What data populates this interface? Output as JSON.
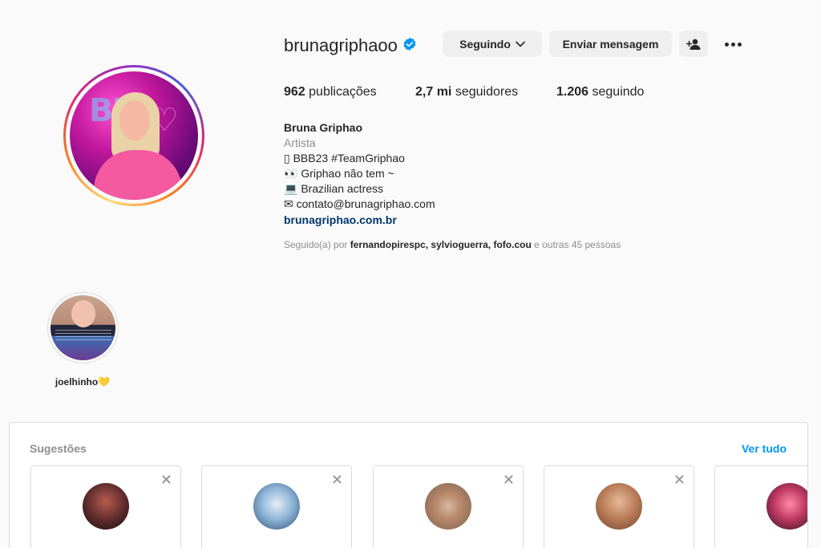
{
  "profile": {
    "username": "brunagriphaoo",
    "verified": true,
    "buttons": {
      "following": "Seguindo",
      "message": "Enviar mensagem"
    },
    "stats": {
      "posts_count": "962",
      "posts_label": "publicações",
      "followers_count": "2,7 mi",
      "followers_label": "seguidores",
      "following_count": "1.206",
      "following_label": "seguindo"
    },
    "bio": {
      "name": "Bruna Griphao",
      "category": "Artista",
      "lines": [
        "▯ BBB23 #TeamGriphao",
        "👀 Griphao não tem ~",
        "💻 Brazilian actress",
        "✉ contato@brunagriphao.com"
      ],
      "link": "brunagriphao.com.br"
    },
    "followed_by": {
      "prefix": "Seguido(a) por",
      "users": "fernandopirespc, sylvioguerra, fofo.cou",
      "suffix": "e outras 45 pessoas"
    }
  },
  "highlights": [
    {
      "label": "joelhinho💛"
    }
  ],
  "suggestions": {
    "title": "Sugestões",
    "see_all": "Ver tudo",
    "close_glyph": "✕"
  },
  "colors": {
    "accent_blue": "#0095f6",
    "link_blue": "#00376b",
    "verified_blue": "#0095f6",
    "muted_text": "#8e8e8e",
    "button_bg": "#efefef"
  }
}
